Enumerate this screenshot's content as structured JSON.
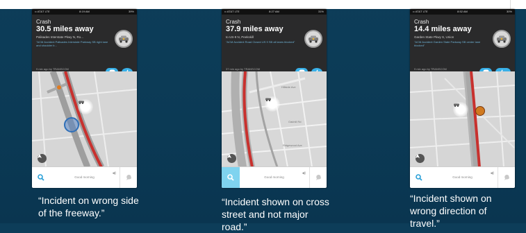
{
  "phones": [
    {
      "status": {
        "carrier": "•• AT&T LTE",
        "time": "8:19 AM",
        "battery": "39%"
      },
      "card": {
        "type": "Crash",
        "distance": "30.5 miles away",
        "road": "Palisades Interstate Pkwy N, Ro...",
        "description": "\"ACM Accident Palisades Interstate Parkway SB right lane and shoulder b...",
        "reported": "9 min ago by TRANSCOM"
      },
      "like_count": "",
      "search_active": false,
      "greeting": "Good morning"
    },
    {
      "status": {
        "carrier": "•• AT&T LTE",
        "time": "8:27 AM",
        "battery": "31%"
      },
      "card": {
        "type": "Crash",
        "distance": "37.9 miles away",
        "road": "to US-9 N, Peekskill",
        "description": "\"ACM Accident Road Closed US 9 SB all lanes blocked\"",
        "reported": "37 min ago by TRANSCOM"
      },
      "like_count": "",
      "search_active": true,
      "greeting": "Good morning"
    },
    {
      "status": {
        "carrier": "•• AT&T LTE",
        "time": "8:52 AM",
        "battery": "30%"
      },
      "card": {
        "type": "Crash",
        "distance": "14.4 miles away",
        "road": "Garden State Pkwy S, Union",
        "description": "\"ACM Accident Garden State Parkway SB center lane blocked\"",
        "reported": "9 min ago by TRANSCOM"
      },
      "like_count": "1",
      "search_active": false,
      "greeting": "Good morning"
    }
  ],
  "captions": [
    {
      "lines": [
        "“Incident on wrong side",
        "of the freeway.”"
      ]
    },
    {
      "lines": [
        "“Incident shown on cross",
        "street and not major",
        "road.”"
      ]
    },
    {
      "lines": [
        "“Incident shown on",
        "wrong  direction of",
        "travel.”"
      ]
    }
  ],
  "map_labels": {
    "phone2": [
      "Hillside Ave",
      "Oakhill Rd",
      "Ridgewood Ave"
    ]
  },
  "colors": {
    "accent": "#38b0e8",
    "incident_road": "#c8312e",
    "background": "#0c3b57"
  }
}
